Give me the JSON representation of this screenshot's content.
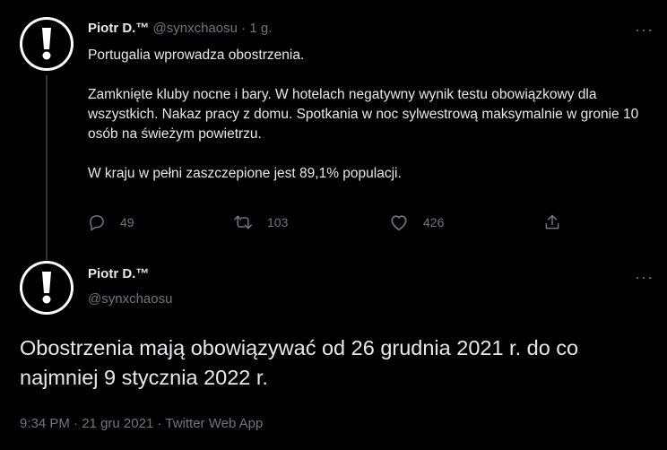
{
  "tweet1": {
    "author_name": "Piotr D.™",
    "handle": "@synxchaosu",
    "separator": "·",
    "time": "1 g.",
    "paragraphs": [
      "Portugalia wprowadza obostrzenia.",
      "Zamknięte kluby nocne i bary. W hotelach negatywny wynik testu obowiązkowy dla wszystkich. Nakaz pracy z domu. Spotkania w noc sylwestrową maksymalnie w gronie 10 osób na świeżym powietrzu.",
      "W kraju w pełni zaszczepione jest 89,1% populacji."
    ],
    "reply_count": "49",
    "retweet_count": "103",
    "like_count": "426",
    "more": "···"
  },
  "tweet2": {
    "author_name": "Piotr D.™",
    "handle": "@synxchaosu",
    "text": "Obostrzenia mają obowiązywać od 26 grudnia 2021 r. do co najmniej 9 stycznia 2022 r.",
    "meta_time": "9:34 PM",
    "meta_sep1": "·",
    "meta_date": "21 gru 2021",
    "meta_sep2": "·",
    "meta_app": "Twitter Web App",
    "more": "···"
  },
  "icons": {
    "avatar": "exclamation-icon",
    "reply": "reply-icon",
    "retweet": "retweet-icon",
    "like": "heart-icon",
    "share": "share-icon"
  },
  "colors": {
    "background": "#000000",
    "text": "#e7e9ea",
    "muted": "#71767b",
    "thread_line": "#333639"
  }
}
